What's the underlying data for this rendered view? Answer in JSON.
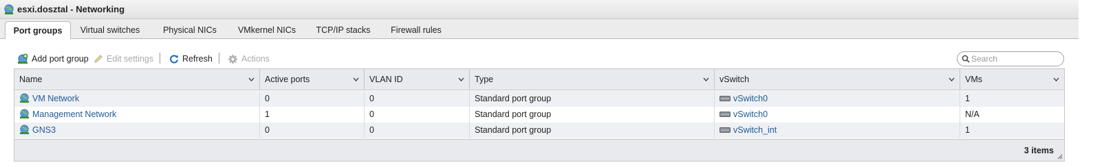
{
  "window": {
    "title": "esxi.dosztal - Networking",
    "title_icon": "network-globe-icon"
  },
  "tabs": [
    {
      "label": "Port groups",
      "active": true
    },
    {
      "label": "Virtual switches",
      "active": false
    },
    {
      "label": "Physical NICs",
      "active": false
    },
    {
      "label": "VMkernel NICs",
      "active": false
    },
    {
      "label": "TCP/IP stacks",
      "active": false
    },
    {
      "label": "Firewall rules",
      "active": false
    }
  ],
  "toolbar": {
    "add_label": "Add port group",
    "edit_label": "Edit settings",
    "refresh_label": "Refresh",
    "actions_label": "Actions",
    "search_placeholder": "Search",
    "search_value": ""
  },
  "table": {
    "columns": [
      "Name",
      "Active ports",
      "VLAN ID",
      "Type",
      "vSwitch",
      "VMs"
    ],
    "rows": [
      {
        "name": "VM Network",
        "active_ports": "0",
        "vlan_id": "0",
        "type": "Standard port group",
        "vswitch": "vSwitch0",
        "vms": "1"
      },
      {
        "name": "Management Network",
        "active_ports": "1",
        "vlan_id": "0",
        "type": "Standard port group",
        "vswitch": "vSwitch0",
        "vms": "N/A"
      },
      {
        "name": "GNS3",
        "active_ports": "0",
        "vlan_id": "0",
        "type": "Standard port group",
        "vswitch": "vSwitch_int",
        "vms": "1"
      }
    ],
    "item_count": "3 items"
  },
  "colors": {
    "link": "#1f5a96",
    "header_bg": "#e9eaee",
    "alt_row_bg": "#eef0f3"
  }
}
